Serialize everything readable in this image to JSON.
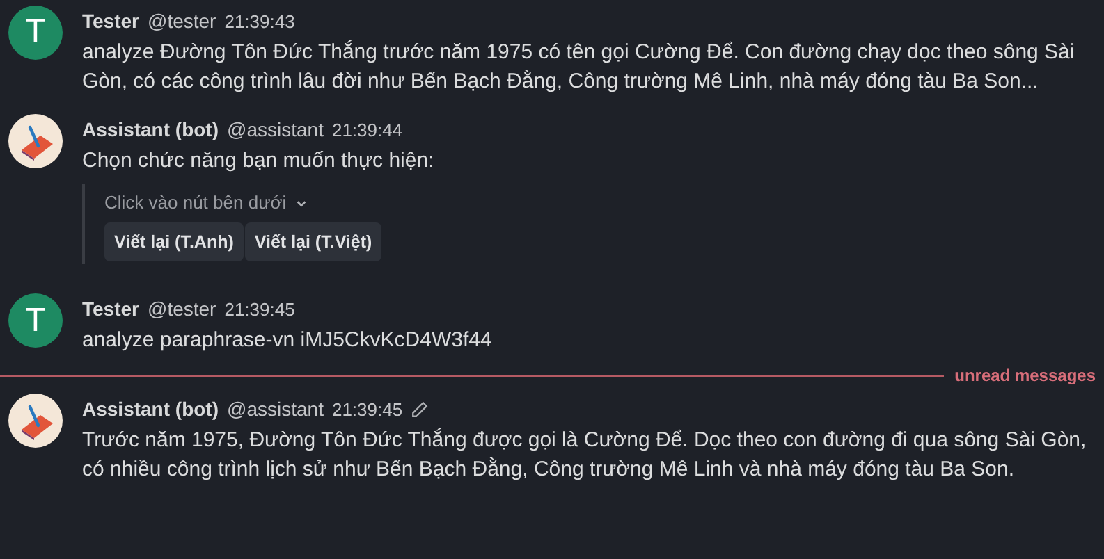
{
  "messages": [
    {
      "kind": "message",
      "avatar": {
        "kind": "letter",
        "text": "T"
      },
      "author": "Tester",
      "handle": "@tester",
      "time": "21:39:43",
      "edited": false,
      "text": "analyze Đường Tôn Đức Thắng trước năm 1975 có tên gọi Cường Để. Con đường chạy dọc theo sông Sài Gòn, có các công trình lâu đời như Bến Bạch Đằng, Công trường Mê Linh, nhà máy đóng tàu Ba Son..."
    },
    {
      "kind": "message",
      "avatar": {
        "kind": "drawing"
      },
      "author": "Assistant (bot)",
      "handle": "@assistant",
      "time": "21:39:44",
      "edited": false,
      "text": "Chọn chức năng bạn muốn thực hiện:",
      "embed": {
        "title": "Click vào nút bên dưới",
        "expanded": true,
        "buttons": [
          "Viết lại (T.Anh)",
          "Viết lại (T.Việt)"
        ]
      }
    },
    {
      "kind": "message",
      "avatar": {
        "kind": "letter",
        "text": "T"
      },
      "author": "Tester",
      "handle": "@tester",
      "time": "21:39:45",
      "edited": false,
      "text": "analyze paraphrase-vn iMJ5CkvKcD4W3f44"
    },
    {
      "kind": "divider",
      "label": "unread messages"
    },
    {
      "kind": "message",
      "avatar": {
        "kind": "drawing"
      },
      "author": "Assistant (bot)",
      "handle": "@assistant",
      "time": "21:39:45",
      "edited": true,
      "text": "Trước năm 1975, Đường Tôn Đức Thắng được gọi là Cường Để. Dọc theo con đường đi qua sông Sài Gòn, có nhiều công trình lịch sử như Bến Bạch Đằng, Công trường Mê Linh và nhà máy đóng tàu Ba Son."
    }
  ]
}
